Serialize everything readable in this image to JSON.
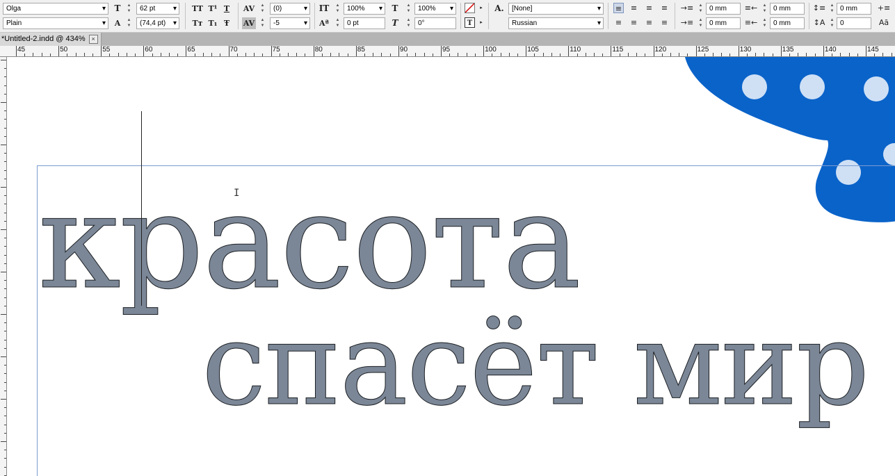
{
  "control_panel": {
    "font_family": "Olga",
    "font_style": "Plain",
    "font_size": "62 pt",
    "leading": "(74,4 pt)",
    "kerning": "(0)",
    "tracking": "-5",
    "vertical_scale": "100%",
    "horizontal_scale": "100%",
    "baseline_shift": "0 pt",
    "skew": "0°",
    "char_style": "[None]",
    "language": "Russian",
    "left_indent": "0 mm",
    "first_line_indent": "0 mm",
    "right_indent": "0 mm",
    "last_line_indent": "0 mm",
    "space_before": "0 mm",
    "drop_cap_lines": "0",
    "caps_labels": [
      "TT",
      "T¹",
      "T",
      "Tт",
      "T₁",
      "Ŧ"
    ],
    "align_icons": [
      "align-left-icon",
      "align-center-icon",
      "align-right-icon",
      "justify-icon"
    ]
  },
  "tab": {
    "title": "*Untitled-2.indd @ 434%",
    "close": "×"
  },
  "ruler": {
    "labels": [
      "45",
      "50",
      "55",
      "60",
      "65",
      "70",
      "75",
      "80",
      "85",
      "90",
      "95",
      "100",
      "105",
      "110",
      "115",
      "120",
      "125",
      "130",
      "135",
      "140",
      "145"
    ]
  },
  "canvas": {
    "line1": "красота",
    "line2": "спасёт мир"
  },
  "colors": {
    "text_fill": "#7b8797",
    "text_stroke": "#1b1e22",
    "butterfly_blue": "#0a63c9",
    "frame_guide": "#7a9ccf"
  },
  "icons": {
    "fill_stroke": "fill-none-icon",
    "ibeam": "I"
  }
}
